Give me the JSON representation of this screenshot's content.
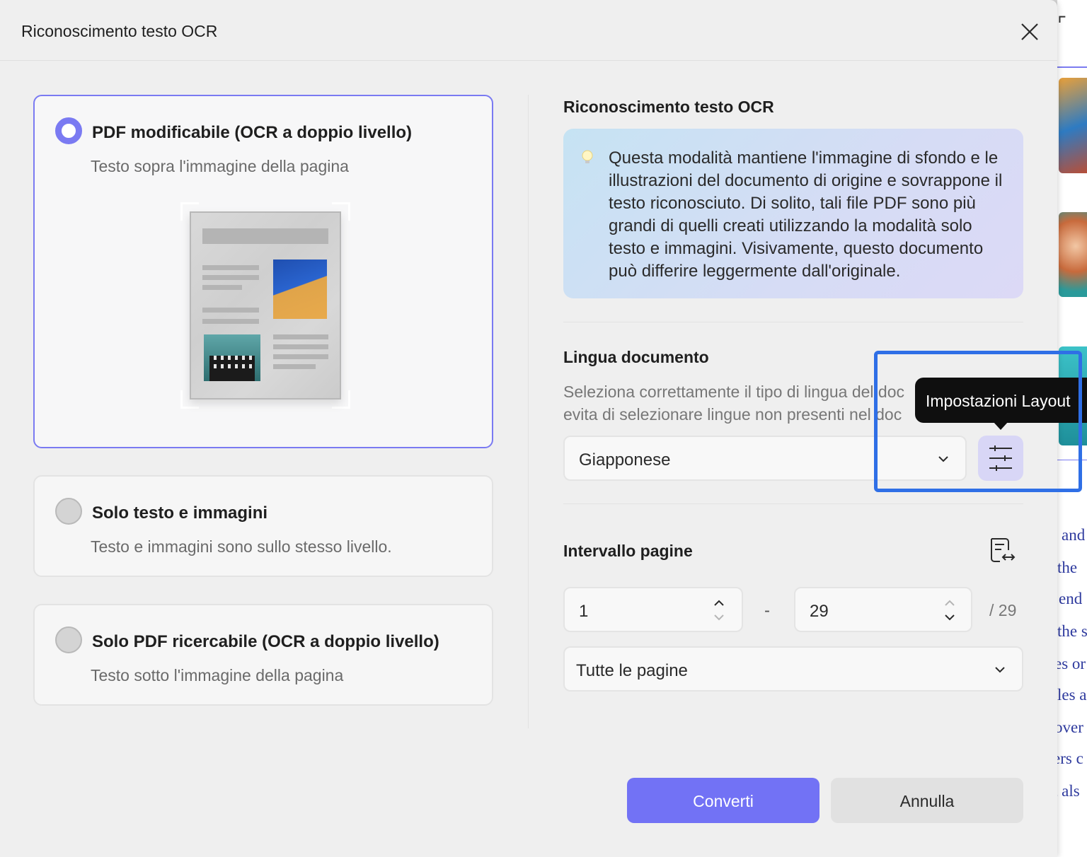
{
  "dialog": {
    "title": "Riconoscimento testo OCR",
    "close_icon": "close-icon"
  },
  "options": [
    {
      "title": "PDF modificabile (OCR a doppio livello)",
      "subtitle": "Testo sopra l'immagine della pagina",
      "selected": true
    },
    {
      "title": "Solo testo e immagini",
      "subtitle": "Testo e immagini sono sullo stesso livello.",
      "selected": false
    },
    {
      "title": "Solo PDF ricercabile (OCR a doppio livello)",
      "subtitle": "Testo sotto l'immagine della pagina",
      "selected": false
    }
  ],
  "info": {
    "title": "Riconoscimento testo OCR",
    "icon": "lightbulb-icon",
    "text": "Questa modalità mantiene l'immagine di sfondo e le illustrazioni del documento di origine e sovrappone il testo riconosciuto. Di solito, tali file PDF sono più grandi di quelli creati utilizzando la modalità solo testo e immagini. Visivamente, questo documento può differire leggermente dall'originale."
  },
  "language": {
    "title": "Lingua documento",
    "desc_line1": "Seleziona correttamente il tipo di lingua del doc",
    "desc_line2": "evita di selezionare lingue non presenti nel doc",
    "selected": "Giapponese",
    "layout_tooltip": "Impostazioni Layout",
    "layout_icon": "sliders-icon"
  },
  "pages": {
    "title": "Intervallo pagine",
    "from": "1",
    "to": "29",
    "total": "/ 29",
    "separator": "-",
    "range_selected": "Tutte le pagine"
  },
  "buttons": {
    "convert": "Converti",
    "cancel": "Annulla"
  },
  "background_doc": {
    "words": [
      "and",
      "the",
      "end",
      "the s",
      "es or",
      "les a",
      "over",
      "ers c",
      "t als"
    ]
  },
  "colors": {
    "accent": "#7272f5",
    "highlight": "#2f6fe6"
  }
}
